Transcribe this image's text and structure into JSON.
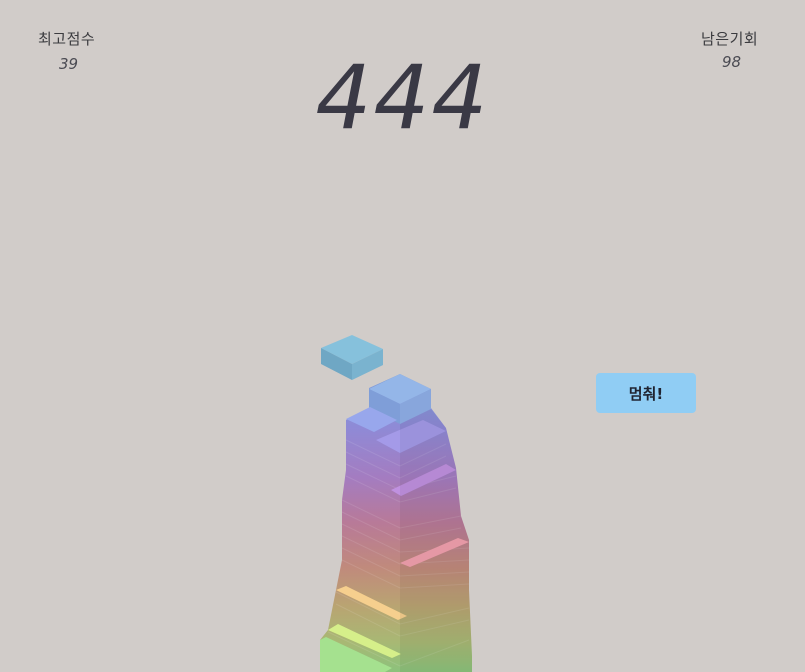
{
  "hud": {
    "best_score_label": "최고점수",
    "best_score_value": "39",
    "remaining_label": "남은기회",
    "remaining_value": "98"
  },
  "current_score": "444",
  "controls": {
    "stop_label": "멈춰!"
  },
  "colors": {
    "background": "#d1ccc9",
    "button": "#90cdf4",
    "score_text": "#3a3945"
  }
}
